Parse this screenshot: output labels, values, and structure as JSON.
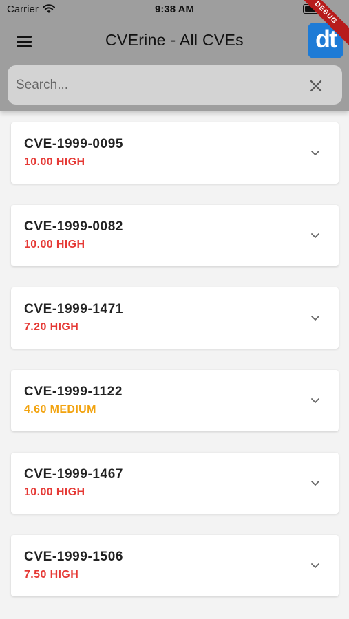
{
  "status_bar": {
    "carrier": "Carrier",
    "time": "9:38 AM"
  },
  "app_bar": {
    "title": "CVErine - All CVEs",
    "logo_text": "dt",
    "debug_banner": "DEBUG"
  },
  "search": {
    "placeholder": "Search...",
    "value": ""
  },
  "colors": {
    "high": "#e53935",
    "medium": "#f2a30f"
  },
  "cves": [
    {
      "id": "CVE-1999-0095",
      "score": "10.00 HIGH",
      "severity": "high"
    },
    {
      "id": "CVE-1999-0082",
      "score": "10.00 HIGH",
      "severity": "high"
    },
    {
      "id": "CVE-1999-1471",
      "score": "7.20 HIGH",
      "severity": "high"
    },
    {
      "id": "CVE-1999-1122",
      "score": "4.60 MEDIUM",
      "severity": "medium"
    },
    {
      "id": "CVE-1999-1467",
      "score": "10.00 HIGH",
      "severity": "high"
    },
    {
      "id": "CVE-1999-1506",
      "score": "7.50 HIGH",
      "severity": "high"
    }
  ]
}
